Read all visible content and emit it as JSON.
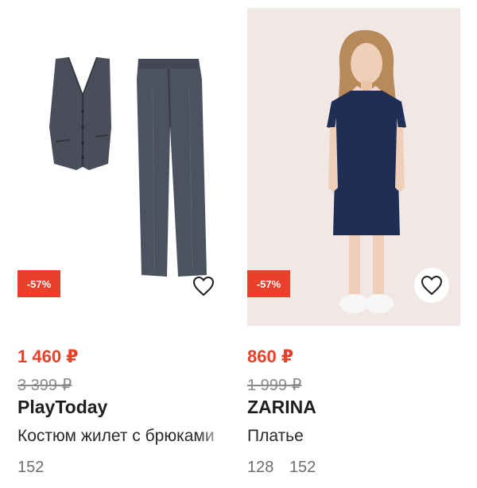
{
  "products": [
    {
      "discount": "-57%",
      "price": "1 460 ₽",
      "old_price": "3 399 ₽",
      "brand": "PlayToday",
      "title": "Костюм жилет с брюками",
      "sizes": [
        "152"
      ],
      "favorite_icon": "heart-outline-icon"
    },
    {
      "discount": "-57%",
      "price": "860 ₽",
      "old_price": "1 999 ₽",
      "brand": "ZARINA",
      "title": "Платье",
      "sizes": [
        "128",
        "152"
      ],
      "favorite_icon": "heart-outline-icon"
    }
  ],
  "colors": {
    "accent": "#e8402a",
    "photo_bg": "#f1e8e5"
  }
}
